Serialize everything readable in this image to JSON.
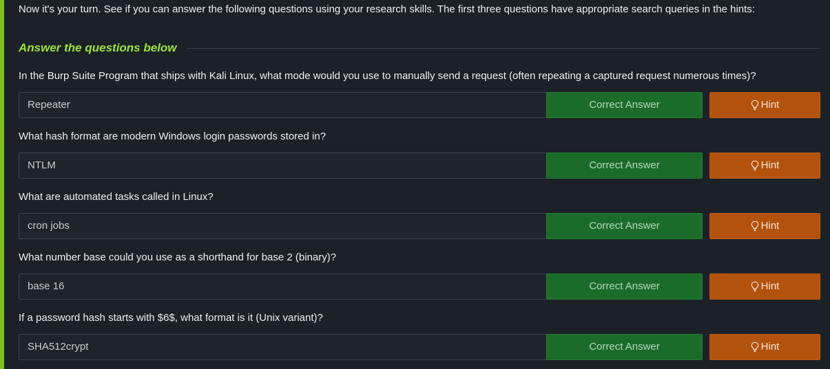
{
  "intro_text": "Now it's your turn. See if you can answer the following questions using your research skills. The first three questions have appropriate search queries in the hints:",
  "section_title": "Answer the questions below",
  "buttons": {
    "correct_label": "Correct Answer",
    "hint_label": "Hint",
    "hint_icon": "lightbulb-icon"
  },
  "questions": [
    {
      "text": "In the Burp Suite Program that ships with Kali Linux, what mode would you use to manually send a request (often repeating a captured request numerous times)?",
      "answer": "Repeater"
    },
    {
      "text": "What hash format are modern Windows login passwords stored in?",
      "answer": "NTLM"
    },
    {
      "text": "What are automated tasks called in Linux?",
      "answer": "cron jobs"
    },
    {
      "text": "What number base could you use as a shorthand for base 2 (binary)?",
      "answer": "base 16"
    },
    {
      "text": "If a password hash starts with $6$, what format is it (Unix variant)?",
      "answer": "SHA512crypt"
    }
  ],
  "colors": {
    "background": "#1c2128",
    "accent_bar": "#7fbf24",
    "section_title": "#9de33a",
    "correct_button": "#1b6b2a",
    "hint_button": "#b2520d"
  }
}
